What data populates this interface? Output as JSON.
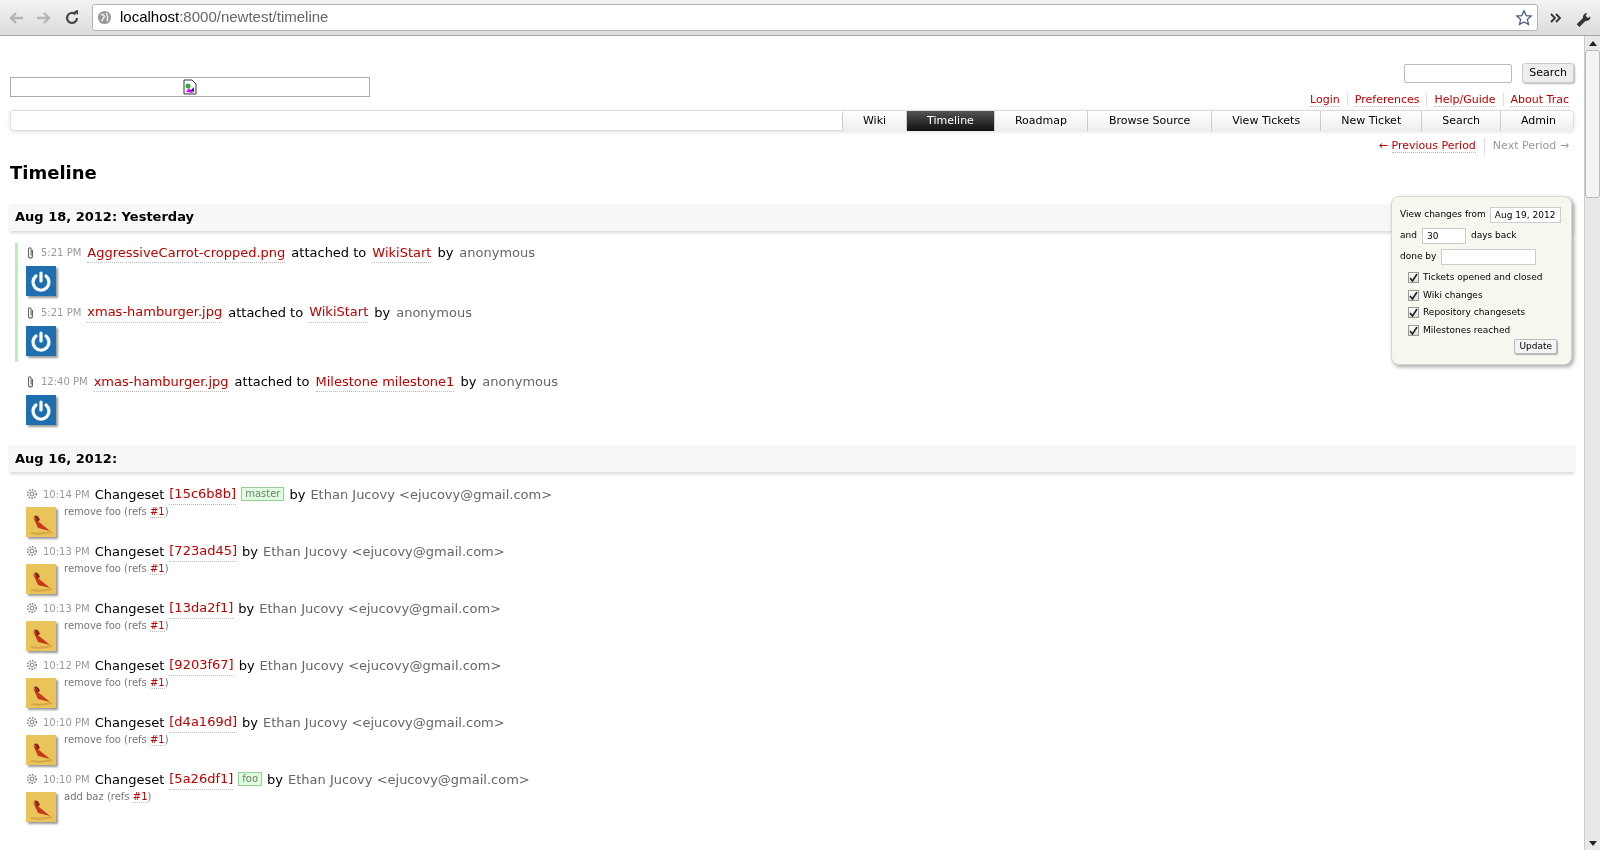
{
  "browser": {
    "url_host": "localhost",
    "url_path": ":8000/newtest/timeline"
  },
  "header": {
    "search_button": "Search",
    "meta_nav": [
      "Login",
      "Preferences",
      "Help/Guide",
      "About Trac"
    ]
  },
  "nav": [
    {
      "label": "Wiki",
      "selected": false
    },
    {
      "label": "Timeline",
      "selected": true
    },
    {
      "label": "Roadmap",
      "selected": false
    },
    {
      "label": "Browse Source",
      "selected": false
    },
    {
      "label": "View Tickets",
      "selected": false
    },
    {
      "label": "New Ticket",
      "selected": false
    },
    {
      "label": "Search",
      "selected": false
    },
    {
      "label": "Admin",
      "selected": false
    }
  ],
  "period_nav": {
    "previous": "Previous Period",
    "previous_arrow": "←",
    "next": "Next Period",
    "next_arrow": "→",
    "next_disabled": true
  },
  "title": "Timeline",
  "filters": {
    "from_label": "View changes from",
    "from_value": "Aug 19, 2012",
    "and_label": "and",
    "days_value": "30",
    "days_label": "days back",
    "done_by_label": "done by",
    "checkboxes": [
      {
        "label": "Tickets opened and closed",
        "checked": true
      },
      {
        "label": "Wiki changes",
        "checked": true
      },
      {
        "label": "Repository changesets",
        "checked": true
      },
      {
        "label": "Milestones reached",
        "checked": true
      }
    ],
    "update_button": "Update"
  },
  "days": [
    {
      "date": "Aug 18, 2012: Yesterday",
      "events": [
        {
          "kind": "attachment",
          "highlighted": true,
          "time": "5:21 PM",
          "file": "AggressiveCarrot-cropped.png",
          "verb": "attached to",
          "target": "WikiStart",
          "by": "by",
          "author": "anonymous"
        },
        {
          "kind": "attachment",
          "highlighted": true,
          "time": "5:21 PM",
          "file": "xmas-hamburger.jpg",
          "verb": "attached to",
          "target": "WikiStart",
          "by": "by",
          "author": "anonymous"
        },
        {
          "kind": "attachment",
          "highlighted": false,
          "time": "12:40 PM",
          "file": "xmas-hamburger.jpg",
          "verb": "attached to",
          "target": "Milestone milestone1",
          "by": "by",
          "author": "anonymous"
        }
      ]
    },
    {
      "date": "Aug 16, 2012:",
      "events": [
        {
          "kind": "changeset",
          "time": "10:14 PM",
          "title": "Changeset",
          "rev": "[15c6b8b]",
          "tag": "master",
          "by": "by",
          "author": "Ethan Jucovy <ejucovy@gmail.com>",
          "message": "remove foo (refs ",
          "ref": "#1",
          "message_end": ")"
        },
        {
          "kind": "changeset",
          "time": "10:13 PM",
          "title": "Changeset",
          "rev": "[723ad45]",
          "by": "by",
          "author": "Ethan Jucovy <ejucovy@gmail.com>",
          "message": "remove foo (refs ",
          "ref": "#1",
          "message_end": ")"
        },
        {
          "kind": "changeset",
          "time": "10:13 PM",
          "title": "Changeset",
          "rev": "[13da2f1]",
          "by": "by",
          "author": "Ethan Jucovy <ejucovy@gmail.com>",
          "message": "remove foo (refs ",
          "ref": "#1",
          "message_end": ")"
        },
        {
          "kind": "changeset",
          "time": "10:12 PM",
          "title": "Changeset",
          "rev": "[9203f67]",
          "by": "by",
          "author": "Ethan Jucovy <ejucovy@gmail.com>",
          "message": "remove foo (refs ",
          "ref": "#1",
          "message_end": ")"
        },
        {
          "kind": "changeset",
          "time": "10:10 PM",
          "title": "Changeset",
          "rev": "[d4a169d]",
          "by": "by",
          "author": "Ethan Jucovy <ejucovy@gmail.com>",
          "message": "remove foo (refs ",
          "ref": "#1",
          "message_end": ")"
        },
        {
          "kind": "changeset",
          "time": "10:10 PM",
          "title": "Changeset",
          "rev": "[5a26df1]",
          "tag": "foo",
          "by": "by",
          "author": "Ethan Jucovy <ejucovy@gmail.com>",
          "message": "add baz (refs ",
          "ref": "#1",
          "message_end": ")"
        }
      ]
    }
  ]
}
